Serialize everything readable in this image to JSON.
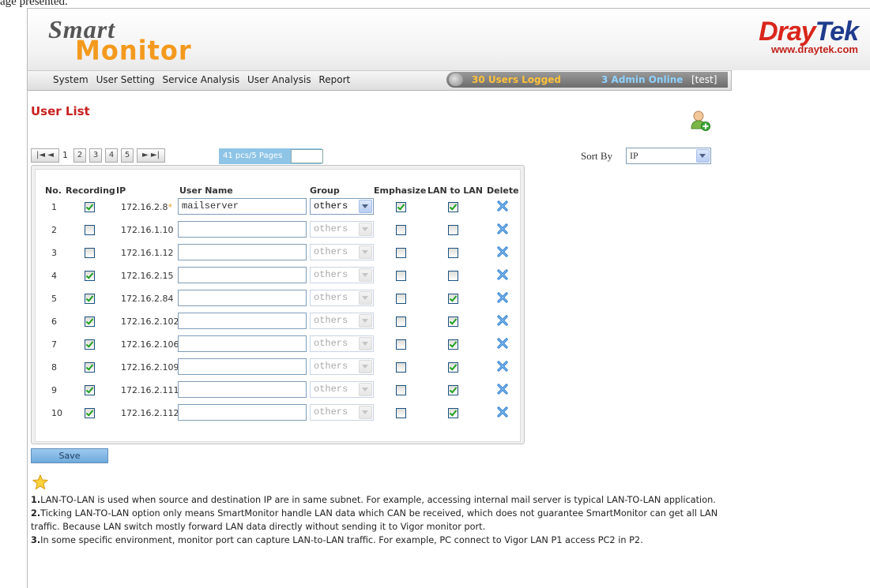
{
  "caption": "age presented.",
  "logo": {
    "part1": "Smart",
    "part2": "Monitor"
  },
  "brand": {
    "name_red": "Dray",
    "name_blue": "Tek",
    "url": "www.draytek.com"
  },
  "nav": {
    "items": [
      "System",
      "User Setting",
      "Service Analysis",
      "User Analysis",
      "Report"
    ],
    "status": {
      "users": "30 Users Logged",
      "admins": "3 Admin Online",
      "user": "[test]"
    }
  },
  "page": {
    "title": "User List"
  },
  "pager": {
    "first": "|◄",
    "prev": "◄",
    "current": "1",
    "pages": [
      "2",
      "3",
      "4",
      "5"
    ],
    "next": "►",
    "last": "►|",
    "info": "41 pcs/5 Pages",
    "jump_value": ""
  },
  "sort": {
    "label": "Sort By",
    "value": "IP"
  },
  "table": {
    "headers": {
      "no": "No.",
      "recording": "Recording",
      "ip": "IP",
      "user_name": "User Name",
      "group": "Group",
      "emphasize": "Emphasize",
      "lan_to_lan": "LAN to LAN",
      "delete": "Delete"
    },
    "rows": [
      {
        "no": "1",
        "recording": true,
        "ip": "172.16.2.8",
        "flag": "*",
        "user_name": "mailserver",
        "group": "others",
        "group_enabled": true,
        "emphasize": true,
        "lan_to_lan": true
      },
      {
        "no": "2",
        "recording": false,
        "ip": "172.16.1.10",
        "flag": "",
        "user_name": "",
        "group": "others",
        "group_enabled": false,
        "emphasize": false,
        "lan_to_lan": false
      },
      {
        "no": "3",
        "recording": false,
        "ip": "172.16.1.12",
        "flag": "",
        "user_name": "",
        "group": "others",
        "group_enabled": false,
        "emphasize": false,
        "lan_to_lan": false
      },
      {
        "no": "4",
        "recording": true,
        "ip": "172.16.2.15",
        "flag": "",
        "user_name": "",
        "group": "others",
        "group_enabled": false,
        "emphasize": false,
        "lan_to_lan": false
      },
      {
        "no": "5",
        "recording": true,
        "ip": "172.16.2.84",
        "flag": "",
        "user_name": "",
        "group": "others",
        "group_enabled": false,
        "emphasize": false,
        "lan_to_lan": true
      },
      {
        "no": "6",
        "recording": true,
        "ip": "172.16.2.102",
        "flag": "",
        "user_name": "",
        "group": "others",
        "group_enabled": false,
        "emphasize": false,
        "lan_to_lan": true
      },
      {
        "no": "7",
        "recording": true,
        "ip": "172.16.2.106",
        "flag": "",
        "user_name": "",
        "group": "others",
        "group_enabled": false,
        "emphasize": false,
        "lan_to_lan": true
      },
      {
        "no": "8",
        "recording": true,
        "ip": "172.16.2.109",
        "flag": "",
        "user_name": "",
        "group": "others",
        "group_enabled": false,
        "emphasize": false,
        "lan_to_lan": true
      },
      {
        "no": "9",
        "recording": true,
        "ip": "172.16.2.111",
        "flag": "",
        "user_name": "",
        "group": "others",
        "group_enabled": false,
        "emphasize": false,
        "lan_to_lan": true
      },
      {
        "no": "10",
        "recording": true,
        "ip": "172.16.2.112",
        "flag": "",
        "user_name": "",
        "group": "others",
        "group_enabled": false,
        "emphasize": false,
        "lan_to_lan": true
      }
    ]
  },
  "save_label": "Save",
  "notes": [
    {
      "num": "1.",
      "text": "LAN-TO-LAN is used when source and destination IP are in same subnet. For example, accessing internal mail server is typical LAN-TO-LAN application."
    },
    {
      "num": "2.",
      "text": "Ticking LAN-TO-LAN option only means SmartMonitor handle LAN data which CAN be received, which does not guarantee SmartMonitor can get all LAN traffic. Because LAN switch mostly forward LAN data directly without sending it to Vigor monitor port."
    },
    {
      "num": "3.",
      "text": "In some specific environment, monitor port can capture LAN-to-LAN traffic. For example, PC connect to Vigor LAN P1 access PC2 in P2."
    }
  ],
  "colors": {
    "title_red": "#c8201f",
    "logo_orange": "#f39a1e",
    "brand_red": "#d9261c",
    "brand_blue": "#1f3b8c",
    "check_green": "#21a121",
    "delete_blue": "#2f7fd0"
  }
}
